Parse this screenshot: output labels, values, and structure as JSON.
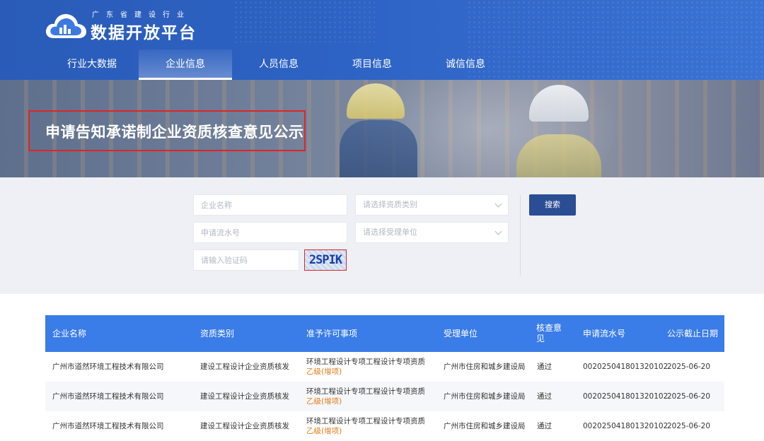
{
  "header": {
    "logo_subtitle": "广东省建设行业",
    "logo_title": "数据开放平台",
    "nav": [
      {
        "label": "行业大数据",
        "active": false
      },
      {
        "label": "企业信息",
        "active": true
      },
      {
        "label": "人员信息",
        "active": false
      },
      {
        "label": "项目信息",
        "active": false
      },
      {
        "label": "诚信信息",
        "active": false
      }
    ]
  },
  "banner": {
    "title": "申请告知承诺制企业资质核查意见公示"
  },
  "search": {
    "company_name_placeholder": "企业名称",
    "qualification_type_placeholder": "请选择资质类别",
    "serial_no_placeholder": "申请流水号",
    "acceptance_unit_placeholder": "请选择受理单位",
    "captcha_placeholder": "请输入验证码",
    "captcha_text": "2SPIK",
    "search_button": "搜索"
  },
  "table": {
    "columns": [
      "企业名称",
      "资质类别",
      "准予许可事项",
      "受理单位",
      "核查意见",
      "申请流水号",
      "公示截止日期"
    ],
    "rows": [
      {
        "company": "广州市道然环境工程技术有限公司",
        "type": "建设工程设计企业资质核发",
        "item": "环境工程设计专项工程设计专项资质",
        "item_grade": "乙级(增项)",
        "unit": "广州市住房和城乡建设局",
        "opinion": "通过",
        "serial": "002025041801320102",
        "deadline": "2025-06-20"
      },
      {
        "company": "广州市道然环境工程技术有限公司",
        "type": "建设工程设计企业资质核发",
        "item": "环境工程设计专项工程设计专项资质",
        "item_grade": "乙级(增项)",
        "unit": "广州市住房和城乡建设局",
        "opinion": "通过",
        "serial": "002025041801320102",
        "deadline": "2025-06-20"
      },
      {
        "company": "广州市道然环境工程技术有限公司",
        "type": "建设工程设计企业资质核发",
        "item": "环境工程设计专项工程设计专项资质",
        "item_grade": "乙级(增项)",
        "unit": "广州市住房和城乡建设局",
        "opinion": "通过",
        "serial": "002025041801320102",
        "deadline": "2025-06-20"
      }
    ]
  },
  "colors": {
    "header_blue": "#2d63c4",
    "table_header_blue": "#3a7ce8",
    "search_button": "#2b4d94",
    "highlight_red": "#e02424",
    "grade_orange": "#e07b1a"
  },
  "icons": [
    "cloud-logo-icon",
    "chevron-down-icon"
  ]
}
